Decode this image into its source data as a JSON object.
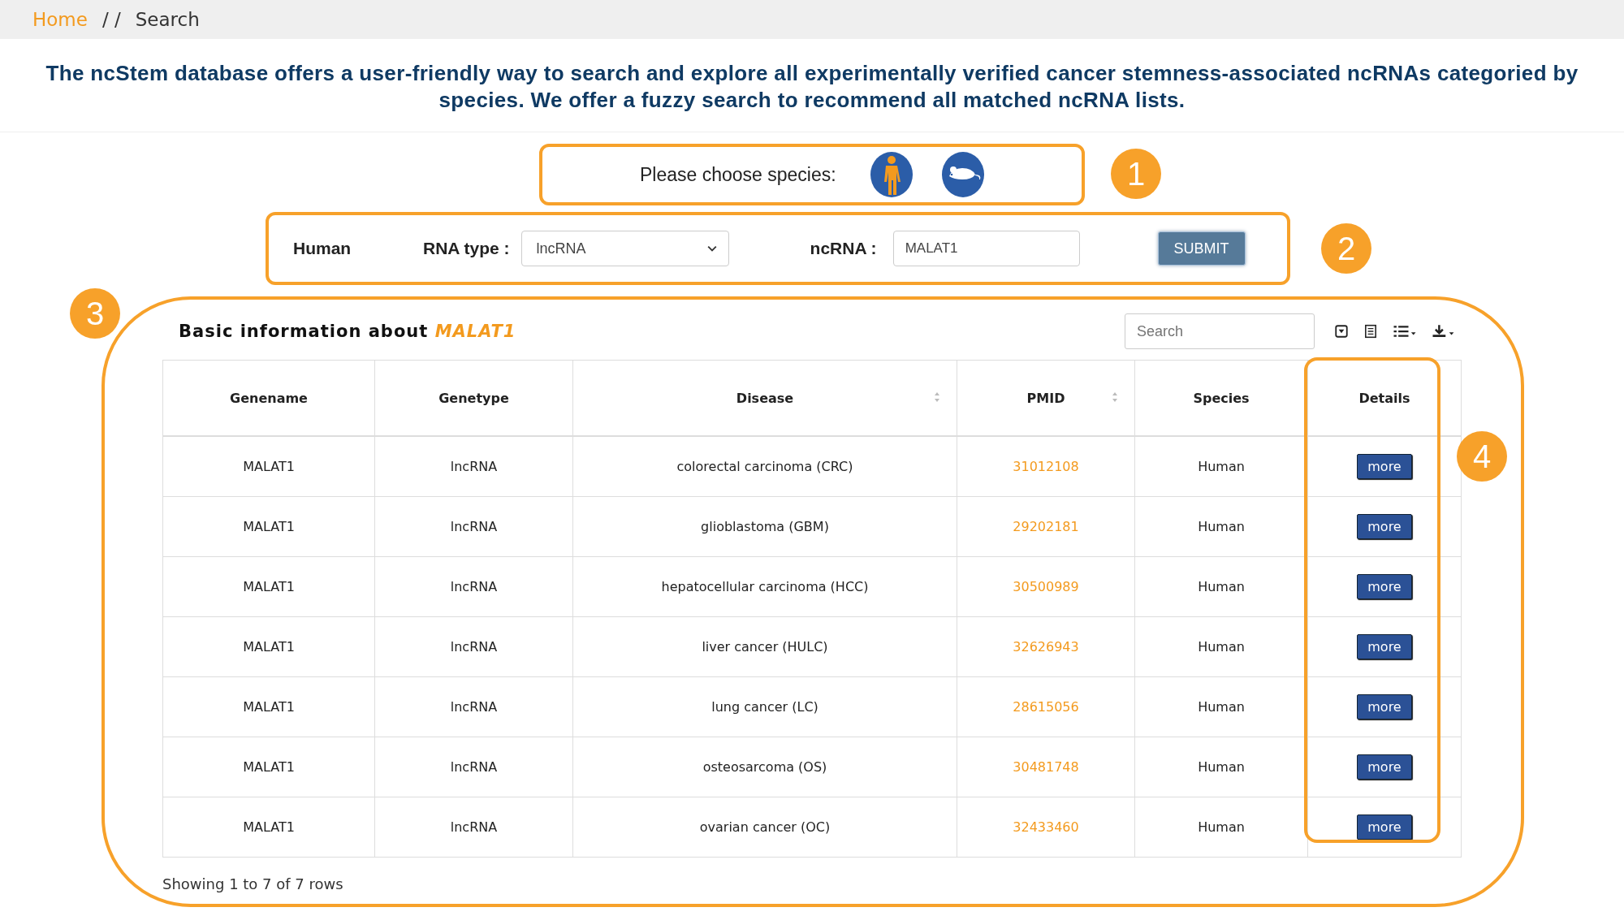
{
  "breadcrumb": {
    "items": [
      {
        "label": "Home",
        "kind": "link"
      },
      {
        "label": "Search",
        "kind": "current"
      }
    ],
    "separator": "/ /"
  },
  "intro": "The ncStem database offers a user-friendly way to search and explore all experimentally verified cancer stemness-associated ncRNAs categoried by species. We offer a fuzzy search to recommend all matched ncRNA lists.",
  "species_picker": {
    "label": "Please choose species:",
    "badge": "1",
    "options": [
      {
        "kind": "human",
        "selected": true
      },
      {
        "kind": "mouse",
        "selected": false
      }
    ]
  },
  "search_form": {
    "badge": "2",
    "species": "Human",
    "rna_type_label": "RNA type :",
    "rna_type_value": "lncRNA",
    "ncrna_label": "ncRNA :",
    "ncrna_value": "MALAT1",
    "submit": "SUBMIT"
  },
  "results": {
    "badge": "3",
    "details_badge": "4",
    "title": "Basic information about **MALAT1**",
    "search_placeholder": "Search",
    "columns": [
      {
        "label": "Genename",
        "sortable": false
      },
      {
        "label": "Genetype",
        "sortable": false
      },
      {
        "label": "Disease",
        "sortable": true
      },
      {
        "label": "PMID",
        "sortable": true
      },
      {
        "label": "Species",
        "sortable": false
      },
      {
        "label": "Details",
        "sortable": false
      }
    ],
    "rows": [
      {
        "genename": "MALAT1",
        "genetype": "lncRNA",
        "disease": "colorectal carcinoma (CRC)",
        "pmid": "31012108",
        "species": "Human",
        "details": "more"
      },
      {
        "genename": "MALAT1",
        "genetype": "lncRNA",
        "disease": "glioblastoma (GBM)",
        "pmid": "29202181",
        "species": "Human",
        "details": "more"
      },
      {
        "genename": "MALAT1",
        "genetype": "lncRNA",
        "disease": "hepatocellular carcinoma (HCC)",
        "pmid": "30500989",
        "species": "Human",
        "details": "more"
      },
      {
        "genename": "MALAT1",
        "genetype": "lncRNA",
        "disease": "liver cancer (HULC)",
        "pmid": "32626943",
        "species": "Human",
        "details": "more"
      },
      {
        "genename": "MALAT1",
        "genetype": "lncRNA",
        "disease": "lung cancer (LC)",
        "pmid": "28615056",
        "species": "Human",
        "details": "more"
      },
      {
        "genename": "MALAT1",
        "genetype": "lncRNA",
        "disease": "osteosarcoma (OS)",
        "pmid": "30481748",
        "species": "Human",
        "details": "more"
      },
      {
        "genename": "MALAT1",
        "genetype": "lncRNA",
        "disease": "ovarian cancer (OC)",
        "pmid": "32433460",
        "species": "Human",
        "details": "more"
      }
    ],
    "footer": "Showing 1 to 7 of 7 rows"
  }
}
